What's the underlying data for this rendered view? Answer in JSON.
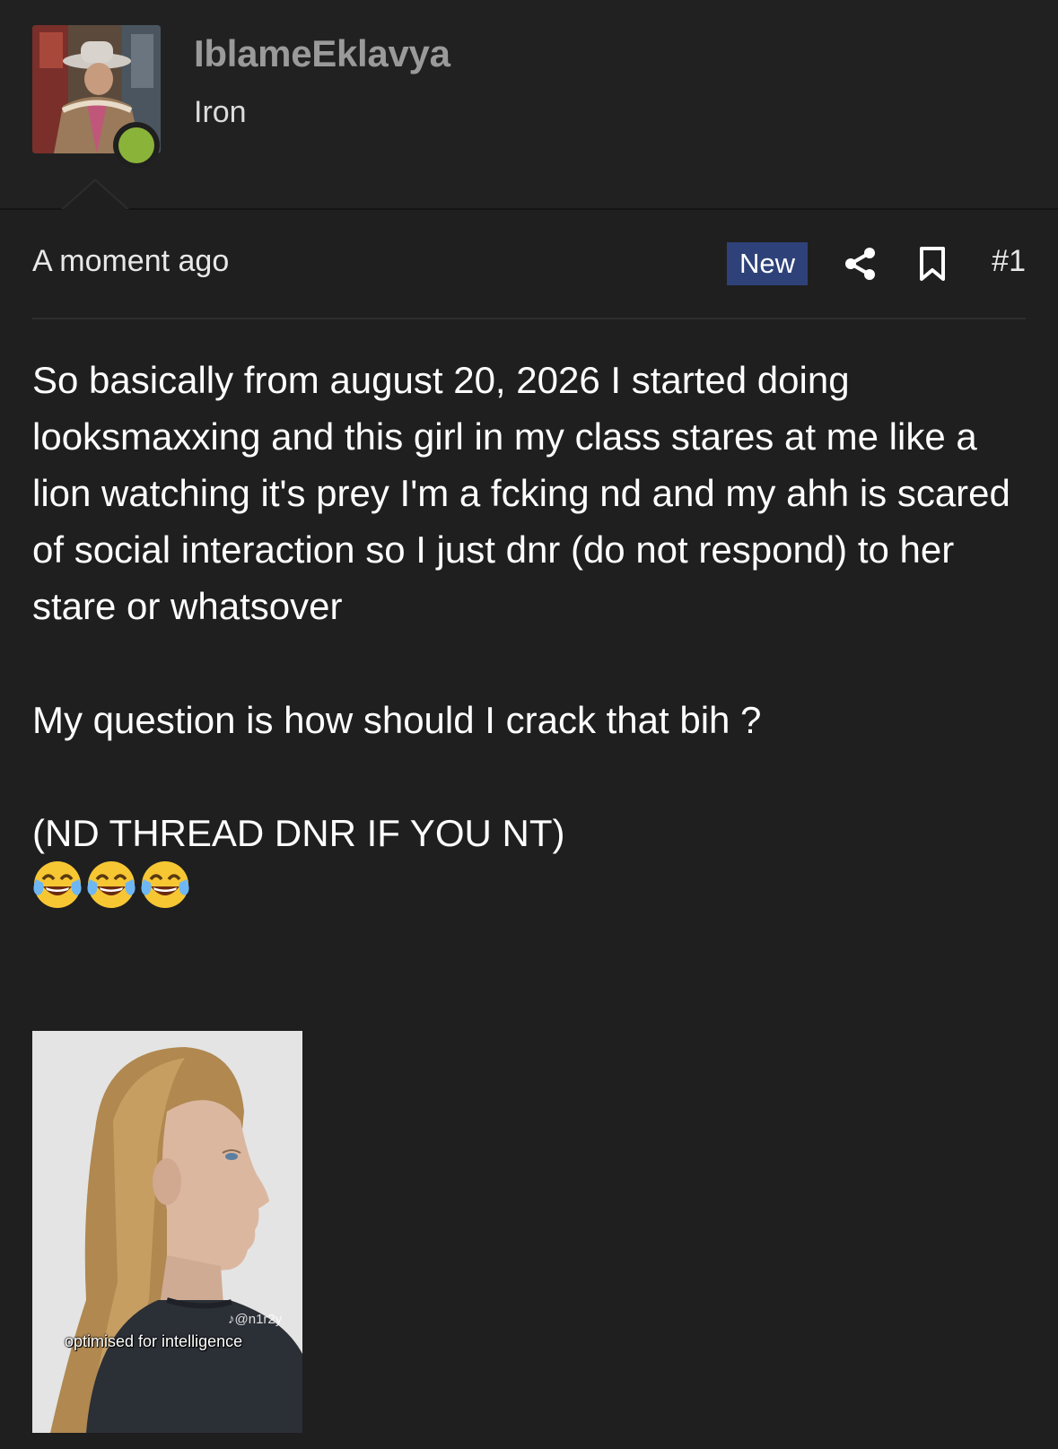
{
  "user": {
    "username": "IblameEklavya",
    "rank": "Iron",
    "online_color": "#8ab33a"
  },
  "post": {
    "timestamp": "A moment ago",
    "badge": "New",
    "post_number": "#1",
    "paragraphs": [
      "So basically from august 20, 2026 I started doing looksmaxxing and this girl in my class stares at me like a lion watching it's prey I'm a fcking nd and my ahh is scared of social interaction so I just dnr (do not respond) to her stare or whatsover",
      "My question is how should I crack that bih ?",
      "(ND THREAD DNR IF YOU NT)"
    ],
    "emojis": [
      "😂",
      "😂",
      "😂"
    ],
    "attachment": {
      "caption": "optimised for intelligence",
      "watermark": "@n1r2y"
    }
  },
  "icons": {
    "share": "share-icon",
    "bookmark": "bookmark-icon"
  },
  "colors": {
    "background": "#1f1f1f",
    "badge": "#2e4178"
  }
}
